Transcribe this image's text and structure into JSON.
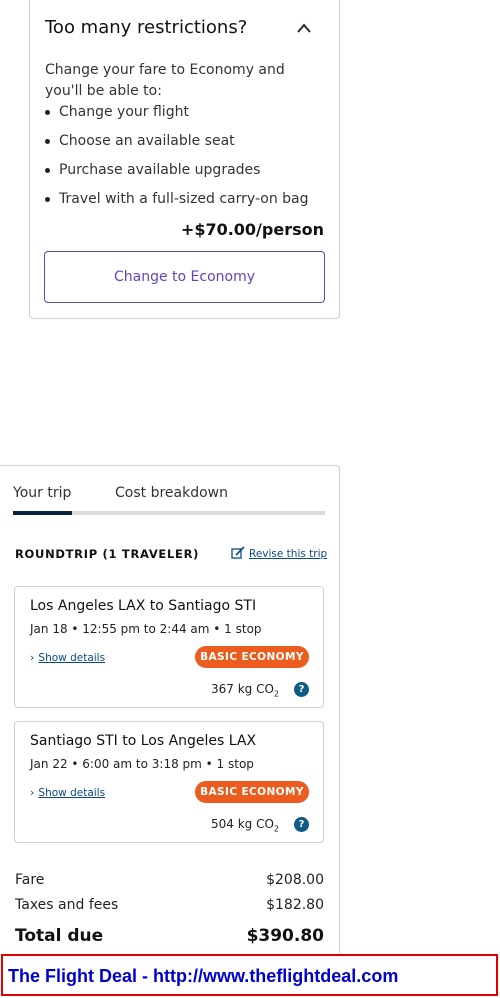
{
  "restrictions": {
    "title": "Too many restrictions?",
    "intro": "Change your fare to Economy and you'll be able to:",
    "benefits": [
      "Change your flight",
      "Choose an available seat",
      "Purchase available upgrades",
      "Travel with a full-sized carry-on bag"
    ],
    "price": "+$70.00/person",
    "button_label": "Change to Economy",
    "collapse_icon": "chevron-up-icon"
  },
  "trip": {
    "tabs": [
      {
        "label": "Your trip",
        "active": true
      },
      {
        "label": "Cost breakdown",
        "active": false
      }
    ],
    "summary_label": "ROUNDTRIP (1 TRAVELER)",
    "revise_label": "Revise this trip",
    "segments": [
      {
        "route": "Los Angeles LAX to Santiago STI",
        "times": "Jan 18 • 12:55 pm to 2:44 am • 1 stop",
        "details_label": "Show details",
        "fare_badge": "BASIC ECONOMY",
        "co2_value": "367 kg CO",
        "co2_sub": "2"
      },
      {
        "route": "Santiago STI to Los Angeles LAX",
        "times": "Jan 22 • 6:00 am to 3:18 pm • 1 stop",
        "details_label": "Show details",
        "fare_badge": "BASIC ECONOMY",
        "co2_value": "504 kg CO",
        "co2_sub": "2"
      }
    ],
    "costs": {
      "fare_label": "Fare",
      "fare_amount": "$208.00",
      "taxes_label": "Taxes and fees",
      "taxes_amount": "$182.80",
      "total_label": "Total due",
      "total_amount": "$390.80"
    }
  },
  "banner": {
    "text": "The Flight Deal - http://www.theflightdeal.com"
  },
  "colors": {
    "accent": "#6244bb",
    "badge": "#eb5c1e",
    "link": "#0a4a86",
    "tab_indicator": "#0c2340",
    "banner_border": "#e00000",
    "banner_text": "#0000cc"
  }
}
